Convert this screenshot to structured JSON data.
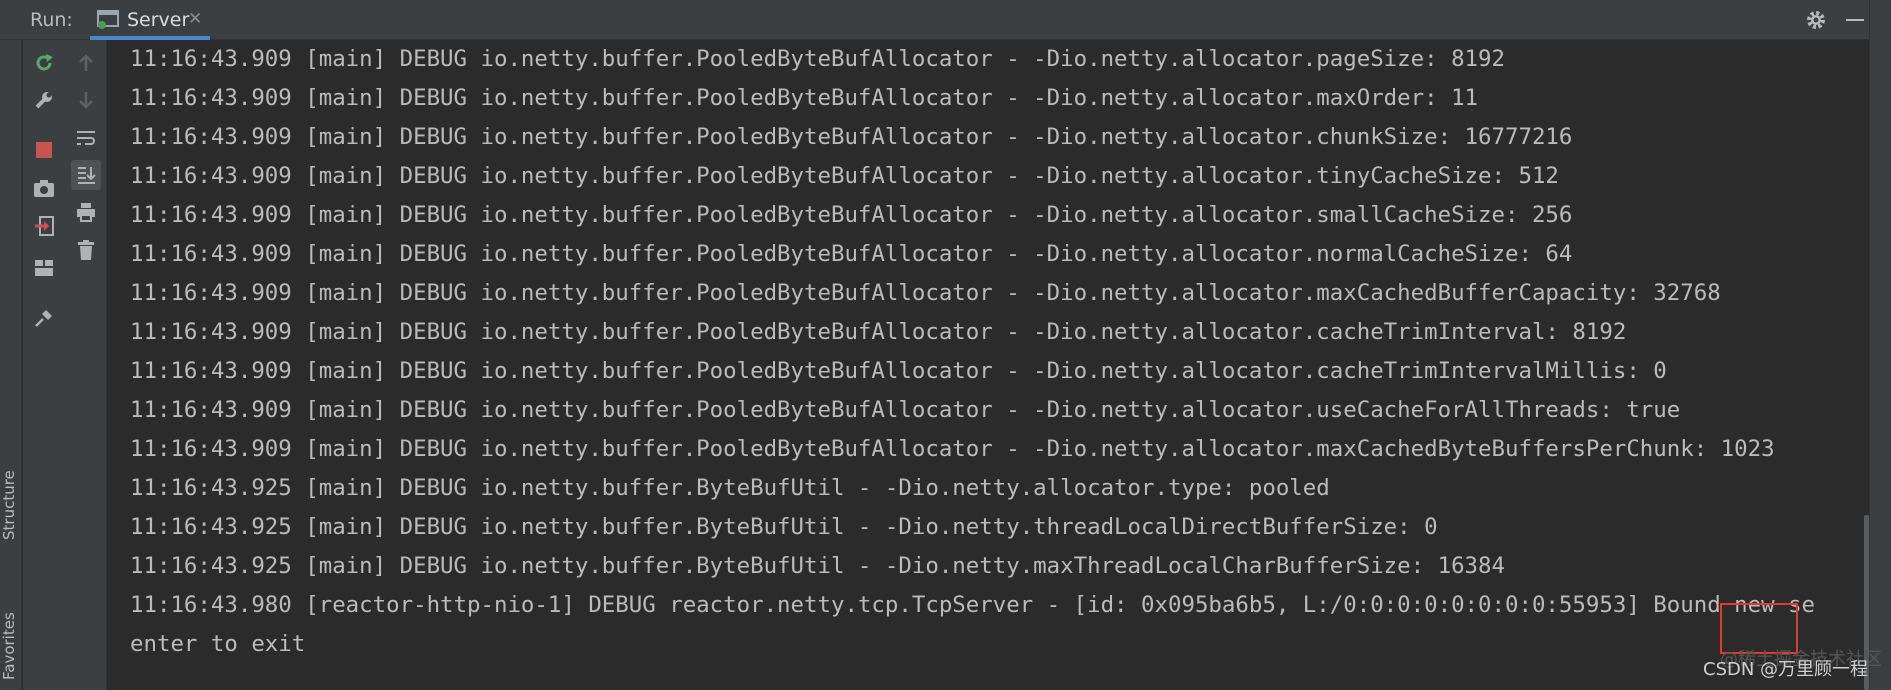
{
  "header": {
    "run_label": "Run:",
    "tab_label": "Server",
    "close_symbol": "✕"
  },
  "stripe": {
    "structure_label": "Structure",
    "favorites_label": "Favorites"
  },
  "toolbar": {
    "rerun": "rerun-icon",
    "settings": "wrench-icon",
    "stop": "stop-icon",
    "screenshot": "camera-icon",
    "exit": "exit-icon",
    "layout": "layout-icon",
    "pin": "pin-icon",
    "up": "arrow-up-icon",
    "down": "arrow-down-icon",
    "wrap": "soft-wrap-icon",
    "scroll_end": "scroll-to-end-icon",
    "print": "print-icon",
    "clear": "trash-icon"
  },
  "console": {
    "lines": [
      "11:16:43.909 [main] DEBUG io.netty.buffer.PooledByteBufAllocator - -Dio.netty.allocator.pageSize: 8192",
      "11:16:43.909 [main] DEBUG io.netty.buffer.PooledByteBufAllocator - -Dio.netty.allocator.maxOrder: 11",
      "11:16:43.909 [main] DEBUG io.netty.buffer.PooledByteBufAllocator - -Dio.netty.allocator.chunkSize: 16777216",
      "11:16:43.909 [main] DEBUG io.netty.buffer.PooledByteBufAllocator - -Dio.netty.allocator.tinyCacheSize: 512",
      "11:16:43.909 [main] DEBUG io.netty.buffer.PooledByteBufAllocator - -Dio.netty.allocator.smallCacheSize: 256",
      "11:16:43.909 [main] DEBUG io.netty.buffer.PooledByteBufAllocator - -Dio.netty.allocator.normalCacheSize: 64",
      "11:16:43.909 [main] DEBUG io.netty.buffer.PooledByteBufAllocator - -Dio.netty.allocator.maxCachedBufferCapacity: 32768",
      "11:16:43.909 [main] DEBUG io.netty.buffer.PooledByteBufAllocator - -Dio.netty.allocator.cacheTrimInterval: 8192",
      "11:16:43.909 [main] DEBUG io.netty.buffer.PooledByteBufAllocator - -Dio.netty.allocator.cacheTrimIntervalMillis: 0",
      "11:16:43.909 [main] DEBUG io.netty.buffer.PooledByteBufAllocator - -Dio.netty.allocator.useCacheForAllThreads: true",
      "11:16:43.909 [main] DEBUG io.netty.buffer.PooledByteBufAllocator - -Dio.netty.allocator.maxCachedByteBuffersPerChunk: 1023",
      "11:16:43.925 [main] DEBUG io.netty.buffer.ByteBufUtil - -Dio.netty.allocator.type: pooled",
      "11:16:43.925 [main] DEBUG io.netty.buffer.ByteBufUtil - -Dio.netty.threadLocalDirectBufferSize: 0",
      "11:16:43.925 [main] DEBUG io.netty.buffer.ByteBufUtil - -Dio.netty.maxThreadLocalCharBufferSize: 16384",
      "11:16:43.980 [reactor-http-nio-1] DEBUG reactor.netty.tcp.TcpServer - [id: 0x095ba6b5, L:/0:0:0:0:0:0:0:0:55953] Bound new se",
      "enter to exit"
    ]
  },
  "watermark": {
    "text": "CSDN @万里顾一程",
    "faint_text": "@稀土掘金技术社区"
  },
  "colors": {
    "background": "#2b2b2b",
    "panel": "#3c3f41",
    "text": "#bbbbbb",
    "highlight": "#e03a2f",
    "accent": "#4a88c7"
  }
}
